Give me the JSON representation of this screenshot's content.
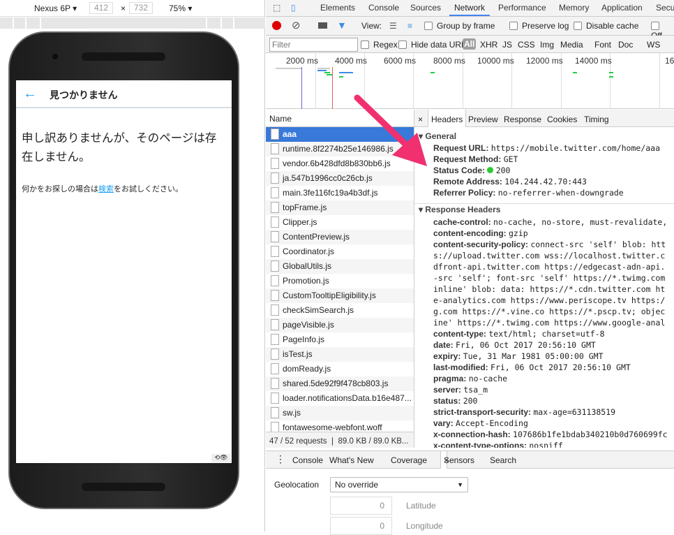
{
  "device_toolbar": {
    "device": "Nexus 6P",
    "width": "412",
    "x": "×",
    "height": "732",
    "zoom": "75%"
  },
  "mobile": {
    "back": "←",
    "title": "見つかりません",
    "message": "申し訳ありませんが、そのページは存在しません。",
    "sub_before": "何かをお探しの場合は",
    "sub_link": "検索",
    "sub_after": "をお試しください。",
    "mini_icon": "⟲👁"
  },
  "devtools": {
    "tabs": [
      "Elements",
      "Console",
      "Sources",
      "Network",
      "Performance",
      "Memory",
      "Application",
      "Secu"
    ],
    "active_tab": "Network",
    "toolbar": {
      "view": "View:",
      "group_by_frame": "Group by frame",
      "preserve_log": "Preserve log",
      "disable_cache": "Disable cache",
      "offline": "Off"
    },
    "filter": {
      "placeholder": "Filter",
      "regex": "Regex",
      "hide_data_urls": "Hide data URLs",
      "types": [
        "All",
        "XHR",
        "JS",
        "CSS",
        "Img",
        "Media",
        "Font",
        "Doc",
        "WS"
      ]
    },
    "timeline_ticks": [
      "2000 ms",
      "4000 ms",
      "6000 ms",
      "8000 ms",
      "10000 ms",
      "12000 ms",
      "14000 ms",
      "16"
    ],
    "name_header": "Name",
    "requests": [
      "aaa",
      "runtime.8f2274b25e146986.js",
      "vendor.6b428dfd8b830bb6.js",
      "ja.547b1996cc0c26cb.js",
      "main.3fe116fc19a4b3df.js",
      "topFrame.js",
      "Clipper.js",
      "ContentPreview.js",
      "Coordinator.js",
      "GlobalUtils.js",
      "Promotion.js",
      "CustomTooltipEligibility.js",
      "checkSimSearch.js",
      "pageVisible.js",
      "PageInfo.js",
      "isTest.js",
      "domReady.js",
      "shared.5de92f9f478cb803.js",
      "loader.notificationsData.b16e487...",
      "sw.js",
      "fontawesome-webfont.woff"
    ],
    "selected_request": "aaa",
    "status": "47 / 52 requests  ❘  89.0 KB / 89.0 KB...",
    "detail_tabs": [
      "×",
      "Headers",
      "Preview",
      "Response",
      "Cookies",
      "Timing"
    ],
    "general_title": "General",
    "general": [
      [
        "Request URL:",
        "https://mobile.twitter.com/home/aaa"
      ],
      [
        "Request Method:",
        "GET"
      ],
      [
        "Status Code:",
        "200"
      ],
      [
        "Remote Address:",
        "104.244.42.70:443"
      ],
      [
        "Referrer Policy:",
        "no-referrer-when-downgrade"
      ]
    ],
    "response_title": "Response Headers",
    "response": [
      [
        "cache-control:",
        "no-cache, no-store, must-revalidate,"
      ],
      [
        "content-encoding:",
        "gzip"
      ],
      [
        "content-security-policy:",
        "connect-src 'self' blob: htt"
      ],
      [
        "",
        "s://upload.twitter.com wss://localhost.twitter.c"
      ],
      [
        "",
        "dfront-api.twitter.com https://edgecast-adn-api."
      ],
      [
        "",
        "-src 'self'; font-src 'self' https://*.twimg.com"
      ],
      [
        "",
        "inline' blob: data: https://*.cdn.twitter.com ht"
      ],
      [
        "",
        "e-analytics.com https://www.periscope.tv https:/"
      ],
      [
        "",
        "g.com https://*.vine.co https://*.pscp.tv; objec"
      ],
      [
        "",
        "ine' https://*.twimg.com https://www.google-anal"
      ],
      [
        "content-type:",
        "text/html; charset=utf-8"
      ],
      [
        "date:",
        "Fri, 06 Oct 2017 20:56:10 GMT"
      ],
      [
        "expiry:",
        "Tue, 31 Mar 1981 05:00:00 GMT"
      ],
      [
        "last-modified:",
        "Fri, 06 Oct 2017 20:56:10 GMT"
      ],
      [
        "pragma:",
        "no-cache"
      ],
      [
        "server:",
        "tsa_m"
      ],
      [
        "status:",
        "200"
      ],
      [
        "strict-transport-security:",
        "max-age=631138519"
      ],
      [
        "vary:",
        "Accept-Encoding"
      ],
      [
        "x-connection-hash:",
        "107686b1fe1bdab340210b0d760699fc"
      ],
      [
        "x-content-type-options:",
        "nosniff"
      ]
    ],
    "drawer_tabs": [
      "Console",
      "What's New",
      "Coverage",
      "Sensors",
      "Search"
    ],
    "active_drawer": "Sensors",
    "sensors": {
      "geolocation_label": "Geolocation",
      "geolocation_value": "No override",
      "latitude_value": "0",
      "latitude_label": "Latitude",
      "longitude_value": "0",
      "longitude_label": "Longitude"
    }
  },
  "colors": {
    "accent": "#4285f4",
    "selected_row": "#3879d9",
    "annotation_arrow": "#f0306f",
    "status_ok": "#2ec82e",
    "twitter_blue": "#1da1f2"
  }
}
